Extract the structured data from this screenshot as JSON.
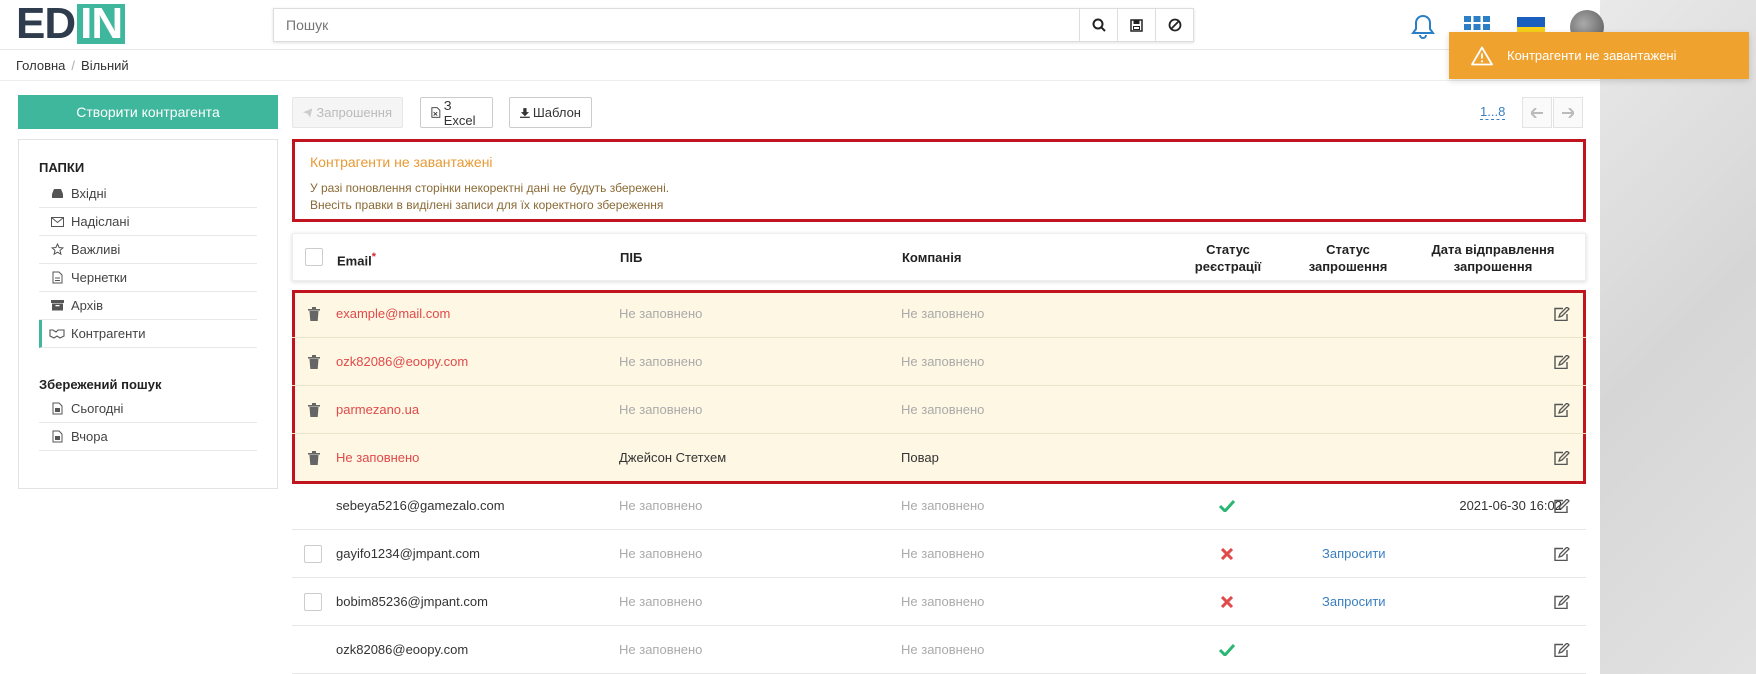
{
  "header": {
    "logo_prefix": "ED",
    "logo_highlight": "IN",
    "search_placeholder": "Пошук"
  },
  "breadcrumb": [
    "Головна",
    "Вільний"
  ],
  "toast": {
    "text": "Контрагенти не завантажені"
  },
  "sidebar": {
    "create_button": "Створити контрагента",
    "folders_title": "ПАПКИ",
    "folders": [
      {
        "label": "Вхідні",
        "icon": "inbox-icon"
      },
      {
        "label": "Надіслані",
        "icon": "envelope-icon"
      },
      {
        "label": "Важливі",
        "icon": "star-icon"
      },
      {
        "label": "Чернетки",
        "icon": "draft-icon"
      },
      {
        "label": "Архів",
        "icon": "archive-icon"
      },
      {
        "label": "Контрагенти",
        "icon": "handshake-icon",
        "active": true
      }
    ],
    "saved_title": "Збережений пошук",
    "saved": [
      {
        "label": "Сьогодні",
        "icon": "doc-icon"
      },
      {
        "label": "Вчора",
        "icon": "doc-icon"
      }
    ]
  },
  "toolbar": {
    "invite": "Запрошення",
    "excel": "З Excel",
    "template": "Шаблон",
    "pages": "1...8"
  },
  "alert": {
    "title": "Контрагенти не завантажені",
    "line1": "У разі поновлення сторінки некоректні дані не будуть збережені.",
    "line2": "Внесіть правки в виділені записи для їх коректного збереження"
  },
  "table": {
    "headers": {
      "email": "Email",
      "required_mark": "*",
      "name": "ПІБ",
      "company": "Компанія",
      "reg_status_1": "Статус",
      "reg_status_2": "реєстрації",
      "inv_status_1": "Статус",
      "inv_status_2": "запрошення",
      "date_1": "Дата відправлення",
      "date_2": "запрошення"
    },
    "error_rows": [
      {
        "email": "example@mail.com",
        "name": "Не заповнено",
        "company": "Не заповнено"
      },
      {
        "email": "ozk82086@eoopy.com",
        "name": "Не заповнено",
        "company": "Не заповнено"
      },
      {
        "email": "parmezano.ua",
        "name": "Не заповнено",
        "company": "Не заповнено"
      },
      {
        "email": "Не заповнено",
        "name": "Джейсон Стетхем",
        "company": "Повар"
      }
    ],
    "rows": [
      {
        "email": "sebeya5216@gamezalo.com",
        "name": "Не заповнено",
        "company": "Не заповнено",
        "reg": "ok",
        "invite": "",
        "date": "2021-06-30 16:02",
        "checkbox": false
      },
      {
        "email": "gayifo1234@jmpant.com",
        "name": "Не заповнено",
        "company": "Не заповнено",
        "reg": "fail",
        "invite": "Запросити",
        "date": "",
        "checkbox": true
      },
      {
        "email": "bobim85236@jmpant.com",
        "name": "Не заповнено",
        "company": "Не заповнено",
        "reg": "fail",
        "invite": "Запросити",
        "date": "",
        "checkbox": true
      },
      {
        "email": "ozk82086@eoopy.com",
        "name": "Не заповнено",
        "company": "Не заповнено",
        "reg": "ok",
        "invite": "",
        "date": "",
        "checkbox": false
      }
    ]
  },
  "colors": {
    "accent": "#3fb79c",
    "error_border": "#c0141e",
    "warning": "#f0a22e",
    "ok": "#2bb673",
    "fail": "#e04a4a"
  }
}
